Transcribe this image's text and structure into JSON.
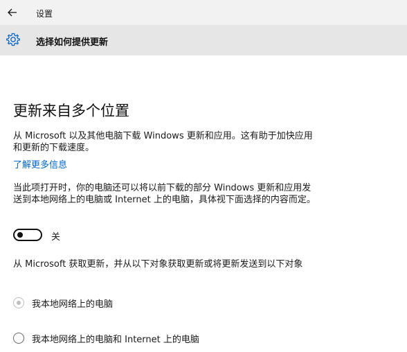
{
  "titlebar": {
    "back_icon": "arrow-left-icon",
    "title": "设置"
  },
  "header": {
    "icon": "gear-icon",
    "title": "选择如何提供更新"
  },
  "main": {
    "heading": "更新来自多个位置",
    "description": "从 Microsoft 以及其他电脑下载 Windows 更新和应用。这有助于加快应用和更新的下载速度。",
    "learn_more_link": "了解更多信息",
    "toggle_description": "当此项打开时，你的电脑还可以将以前下载的部分 Windows 更新和应用发送到本地网络上的电脑或 Internet 上的电脑，具体视下面选择的内容而定。",
    "toggle": {
      "state": "关",
      "on": false
    },
    "radio_group_label": "从 Microsoft 获取更新，并从以下对象获取更新或将更新发送到以下对象",
    "radio_options": [
      {
        "label": "我本地网络上的电脑",
        "selected": true,
        "disabled": true
      },
      {
        "label": "我本地网络上的电脑和 Internet 上的电脑",
        "selected": false,
        "disabled": true
      }
    ]
  },
  "colors": {
    "link": "#0066cc",
    "header_bg": "#e6e6e6",
    "titlebar_bg": "#f2f2f2"
  }
}
